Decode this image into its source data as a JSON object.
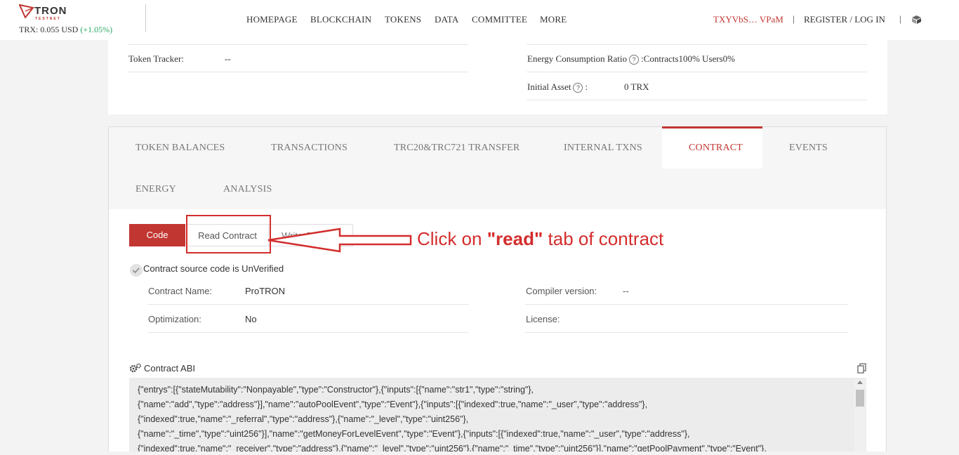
{
  "header": {
    "logo_text": "TRON",
    "logo_sub": "TESTNET",
    "price_prefix": "TRX: 0.055 USD",
    "price_change": "(+1.05%)",
    "nav": [
      "HOMEPAGE",
      "BLOCKCHAIN",
      "TOKENS",
      "DATA",
      "COMMITTEE",
      "MORE"
    ],
    "account": "TXYVbS… VPaM",
    "register": "REGISTER / LOG IN",
    "separator": "|"
  },
  "overview": {
    "token_tracker_label": "Token Tracker:",
    "token_tracker_value": "--",
    "energy_ratio_label": "Energy Consumption Ratio",
    "energy_ratio_value": ":Contracts100%  Users0%",
    "initial_asset_label": "Initial Asset",
    "initial_asset_value": "0 TRX",
    "help": "?"
  },
  "tabs": {
    "row1": [
      "TOKEN BALANCES",
      "TRANSACTIONS",
      "TRC20&TRC721 TRANSFER",
      "INTERNAL TXNS",
      "CONTRACT",
      "EVENTS"
    ],
    "row2": [
      "ENERGY",
      "ANALYSIS"
    ],
    "active": "CONTRACT"
  },
  "contract": {
    "subtabs": [
      "Code",
      "Read Contract",
      "Write Contract"
    ],
    "verify_text": "Contract source code is UnVerified",
    "name_label": "Contract Name:",
    "name_value": "ProTRON",
    "compiler_label": "Compiler version:",
    "compiler_value": "--",
    "optimization_label": "Optimization:",
    "optimization_value": "No",
    "license_label": "License:",
    "abi_title": "Contract ABI",
    "abi_lines": [
      "{\"entrys\":[{\"stateMutability\":\"Nonpayable\",\"type\":\"Constructor\"},{\"inputs\":[{\"name\":\"str1\",\"type\":\"string\"},",
      "{\"name\":\"add\",\"type\":\"address\"}],\"name\":\"autoPoolEvent\",\"type\":\"Event\"},{\"inputs\":[{\"indexed\":true,\"name\":\"_user\",\"type\":\"address\"},",
      "{\"indexed\":true,\"name\":\"_referral\",\"type\":\"address\"},{\"name\":\"_level\",\"type\":\"uint256\"},",
      "{\"name\":\"_time\",\"type\":\"uint256\"}],\"name\":\"getMoneyForLevelEvent\",\"type\":\"Event\"},{\"inputs\":[{\"indexed\":true,\"name\":\"_user\",\"type\":\"address\"},",
      "{\"indexed\":true,\"name\":\"_receiver\",\"type\":\"address\"},{\"name\":\"_level\",\"type\":\"uint256\"},{\"name\":\"_time\",\"type\":\"uint256\"}],\"name\":\"getPoolPayment\",\"type\":\"Event\"},"
    ]
  },
  "annotation": {
    "pre": "Click on ",
    "bold": "\"read\"",
    "post": " tab of contract"
  },
  "colors": {
    "accent": "#c23631",
    "annotation": "#d42d2d",
    "positive": "#2aa864"
  },
  "icons": [
    "tron-logo-icon",
    "cube-icon",
    "check-circle-icon",
    "gears-icon",
    "copy-icon",
    "red-arrow-icon"
  ]
}
